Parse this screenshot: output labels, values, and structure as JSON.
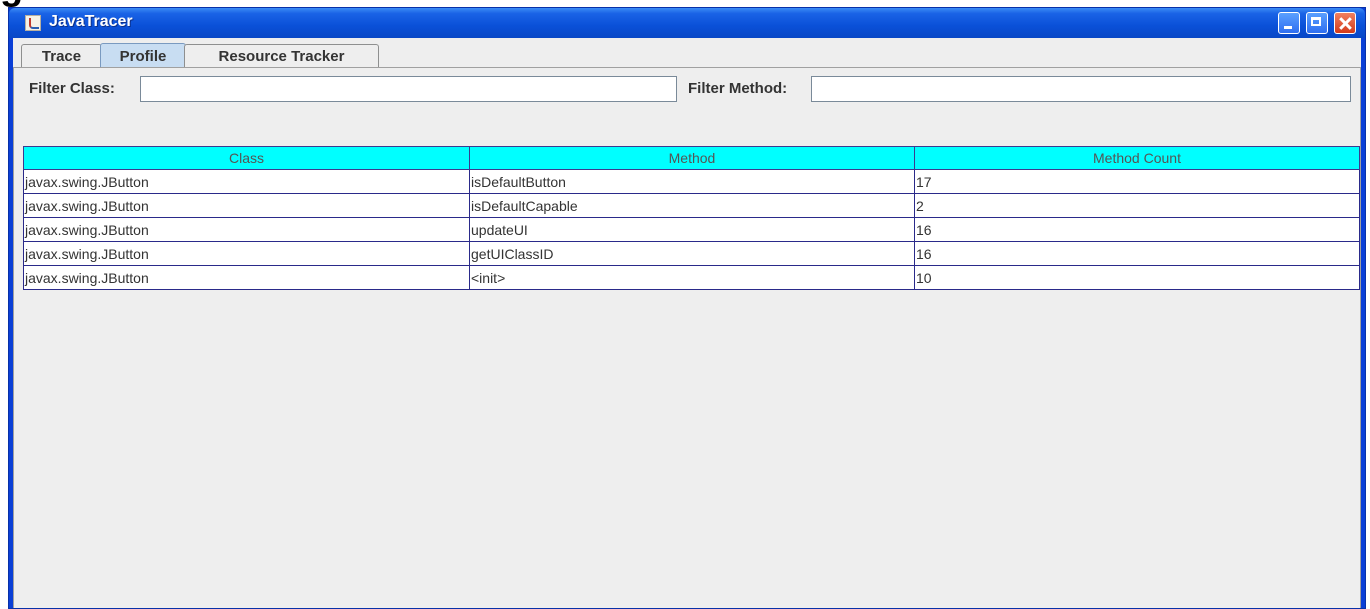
{
  "page": {
    "heading_fragment": "g"
  },
  "window": {
    "title": "JavaTracer",
    "controls": [
      "minimize",
      "maximize",
      "close"
    ]
  },
  "tabs": [
    {
      "label": "Trace",
      "selected": false
    },
    {
      "label": "Profile",
      "selected": true
    },
    {
      "label": "Resource Tracker",
      "selected": false
    }
  ],
  "filters": {
    "class_label": "Filter Class:",
    "class_value": "",
    "method_label": "Filter Method:",
    "method_value": ""
  },
  "table": {
    "headers": [
      "Class",
      "Method",
      "Method Count"
    ],
    "rows": [
      [
        "javax.swing.JButton",
        "isDefaultButton",
        "17"
      ],
      [
        "javax.swing.JButton",
        "isDefaultCapable",
        "2"
      ],
      [
        "javax.swing.JButton",
        "updateUI",
        "16"
      ],
      [
        "javax.swing.JButton",
        "getUIClassID",
        "16"
      ],
      [
        "javax.swing.JButton",
        "<init>",
        "10"
      ]
    ]
  },
  "colors": {
    "title_bar": "#0a50d8",
    "table_header": "#00ffff",
    "selected_tab": "#c8ddf2"
  }
}
